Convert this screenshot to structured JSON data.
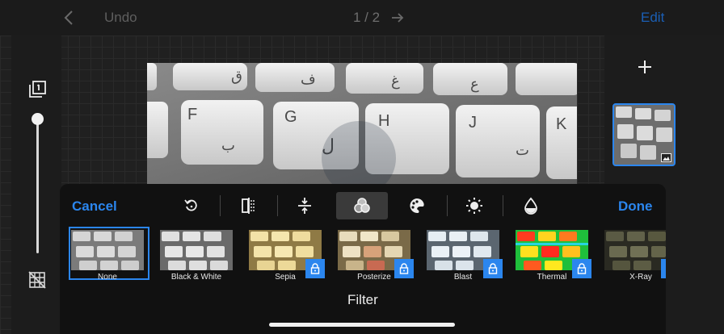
{
  "topbar": {
    "undo_label": "Undo",
    "page_indicator": "1 / 2",
    "edit_label": "Edit"
  },
  "photo_subject": "keyboard-keys",
  "key_labels": [
    "J",
    "H",
    "G",
    "F",
    "K",
    "ق",
    "ف",
    "غ",
    "ع",
    "ت",
    "ل",
    "ب"
  ],
  "panel": {
    "cancel_label": "Cancel",
    "done_label": "Done",
    "title": "Filter",
    "tools": [
      "rotate-icon",
      "flip-icon",
      "straighten-icon",
      "filter-icon",
      "palette-icon",
      "brightness-icon",
      "saturation-icon"
    ],
    "active_tool": "filter-icon",
    "filters": [
      {
        "label": "None",
        "selected": true,
        "locked": false,
        "tint": "#9a9a9a"
      },
      {
        "label": "Black & White",
        "selected": false,
        "locked": false,
        "tint": "#a6a6a6"
      },
      {
        "label": "Sepia",
        "selected": false,
        "locked": true,
        "tint": "#c9b071"
      },
      {
        "label": "Posterize",
        "selected": false,
        "locked": true,
        "tint": "#b8a87a"
      },
      {
        "label": "Blast",
        "selected": false,
        "locked": true,
        "tint": "#a7b4bd"
      },
      {
        "label": "Thermal",
        "selected": false,
        "locked": true,
        "tint": "#38c84a"
      },
      {
        "label": "X-Ray",
        "selected": false,
        "locked": true,
        "tint": "#77775a"
      }
    ]
  },
  "colors": {
    "accent": "#2b86ee",
    "edit_dim": "#1b5fb5"
  },
  "slider": {
    "value": 1.0
  }
}
